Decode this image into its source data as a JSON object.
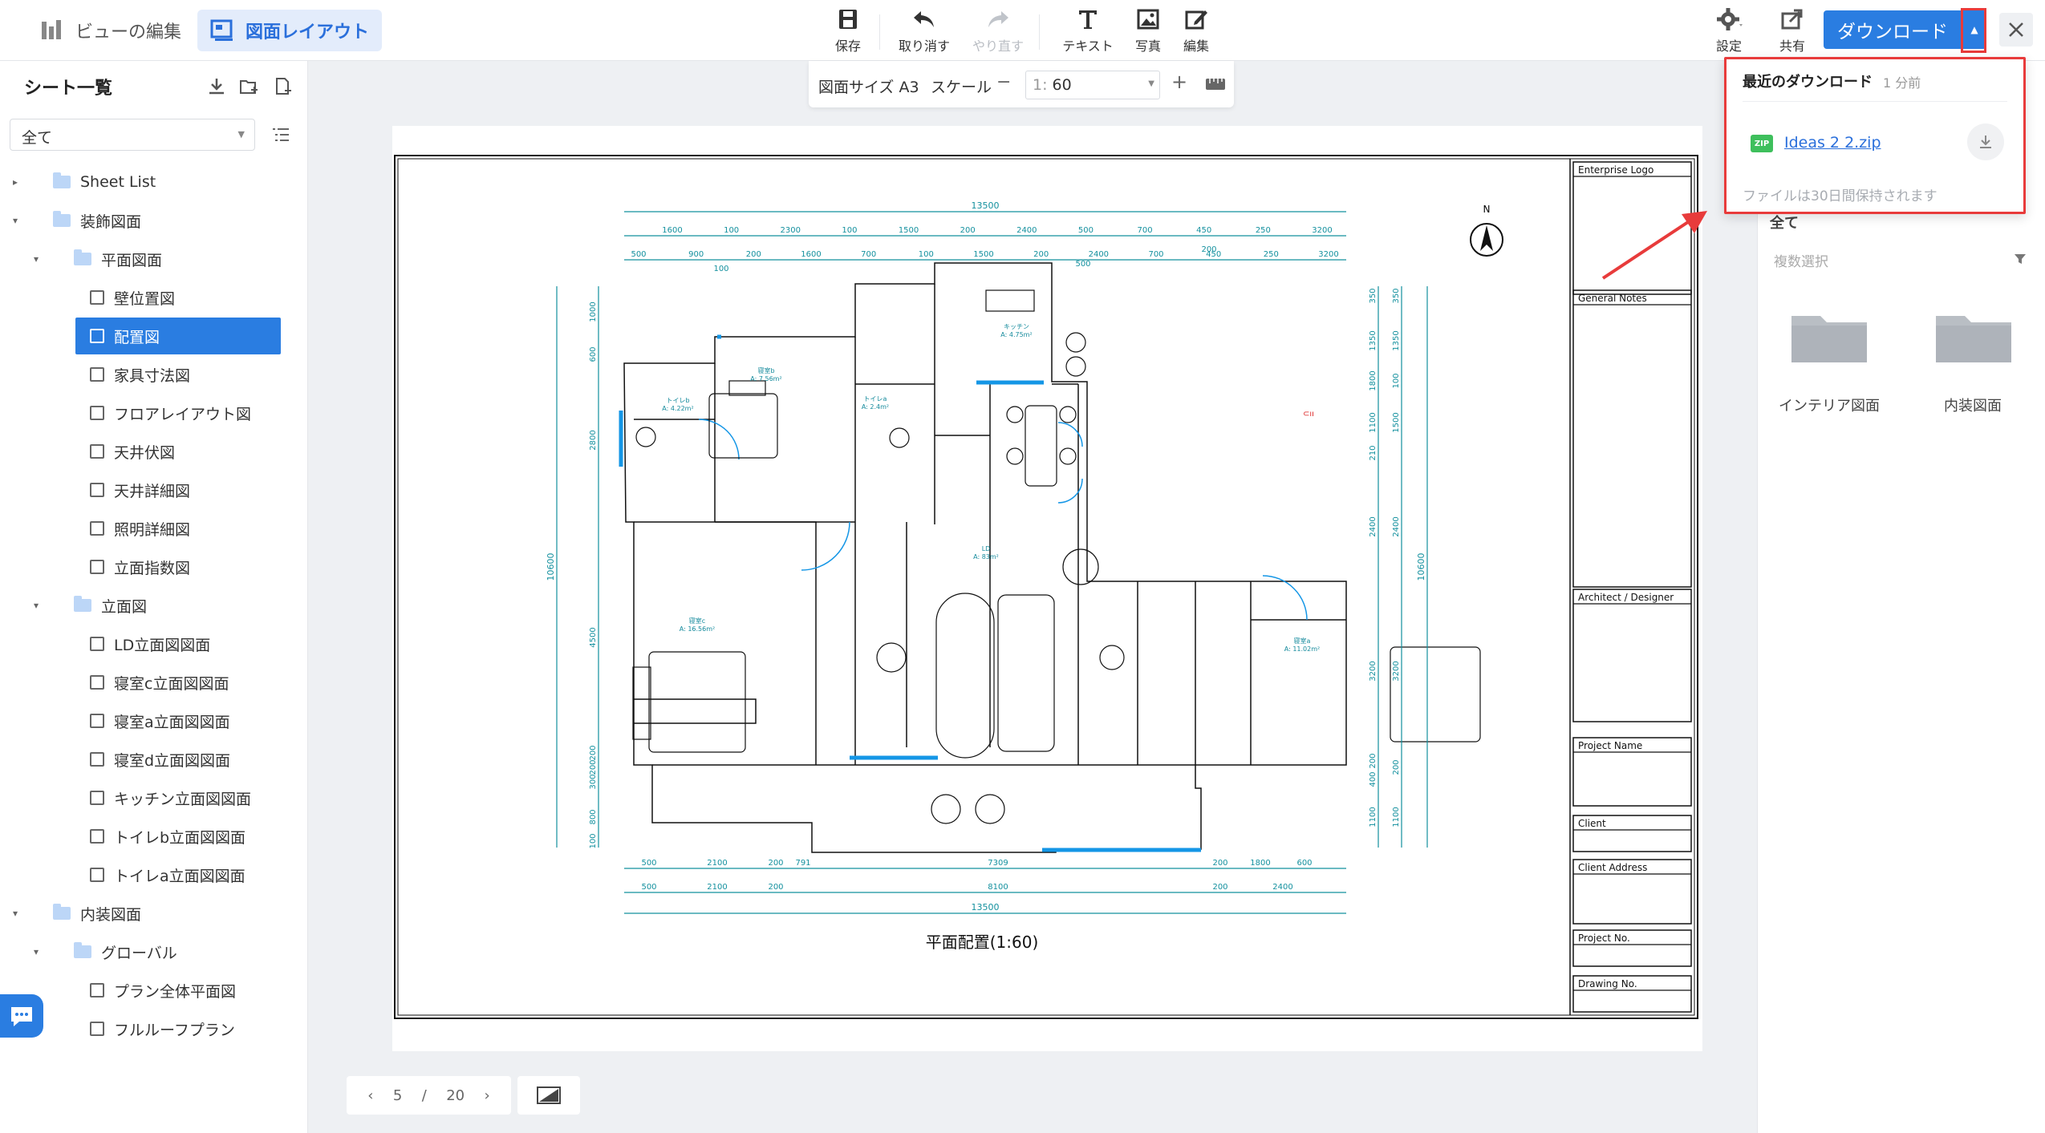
{
  "header": {
    "mode_tabs": [
      {
        "label": "ビューの編集",
        "active": false
      },
      {
        "label": "図面レイアウト",
        "active": true
      }
    ],
    "tools": [
      {
        "label": "保存",
        "icon": "save-icon",
        "disabled": false
      },
      {
        "label": "取り消す",
        "icon": "undo-icon",
        "disabled": false
      },
      {
        "label": "やり直す",
        "icon": "redo-icon",
        "disabled": true
      },
      {
        "label": "テキスト",
        "icon": "text-icon",
        "disabled": false
      },
      {
        "label": "写真",
        "icon": "photo-icon",
        "disabled": false
      },
      {
        "label": "編集",
        "icon": "edit-icon",
        "disabled": false
      }
    ],
    "settings_label": "設定",
    "share_label": "共有",
    "download_label": "ダウンロード",
    "accent_color": "#2a7de1"
  },
  "sidebar": {
    "title": "シート一覧",
    "filter_value": "全て",
    "tree": [
      {
        "label": "Sheet List",
        "type": "folder",
        "level": 0,
        "collapsed": true
      },
      {
        "label": "装飾図面",
        "type": "folder",
        "level": 0
      },
      {
        "label": "平面図面",
        "type": "folder",
        "level": 1
      },
      {
        "label": "壁位置図",
        "type": "sheet",
        "level": 2
      },
      {
        "label": "配置図",
        "type": "sheet",
        "level": 2,
        "selected": true
      },
      {
        "label": "家具寸法図",
        "type": "sheet",
        "level": 2
      },
      {
        "label": "フロアレイアウト図",
        "type": "sheet",
        "level": 2
      },
      {
        "label": "天井伏図",
        "type": "sheet",
        "level": 2
      },
      {
        "label": "天井詳細図",
        "type": "sheet",
        "level": 2
      },
      {
        "label": "照明詳細図",
        "type": "sheet",
        "level": 2
      },
      {
        "label": "立面指数図",
        "type": "sheet",
        "level": 2
      },
      {
        "label": "立面図",
        "type": "folder",
        "level": 1
      },
      {
        "label": "LD立面図図面",
        "type": "sheet",
        "level": 2
      },
      {
        "label": "寝室c立面図図面",
        "type": "sheet",
        "level": 2
      },
      {
        "label": "寝室a立面図図面",
        "type": "sheet",
        "level": 2
      },
      {
        "label": "寝室d立面図図面",
        "type": "sheet",
        "level": 2
      },
      {
        "label": "キッチン立面図図面",
        "type": "sheet",
        "level": 2
      },
      {
        "label": "トイレb立面図図面",
        "type": "sheet",
        "level": 2
      },
      {
        "label": "トイレa立面図図面",
        "type": "sheet",
        "level": 2
      },
      {
        "label": "内装図面",
        "type": "folder",
        "level": 0
      },
      {
        "label": "グローバル",
        "type": "folder",
        "level": 1
      },
      {
        "label": "プラン全体平面図",
        "type": "sheet",
        "level": 2
      },
      {
        "label": "フルルーフプラン",
        "type": "sheet",
        "level": 2
      }
    ]
  },
  "scale_bar": {
    "paper_size_label": "図面サイズ A3",
    "scale_label": "スケール",
    "scale_prefix": "1:",
    "scale_value": "60"
  },
  "drawing": {
    "plan_title": "平面配置(1:60)",
    "north": "N",
    "overall_width_label": "13500",
    "overall_height_label": "10600",
    "top_dims_row1": [
      "1600",
      "100",
      "2300",
      "100",
      "1500",
      "200",
      "2400",
      "500",
      "700",
      "450",
      "250",
      "3200"
    ],
    "top_dims_row2": [
      "500",
      "900",
      "200",
      "1600",
      "700",
      "100",
      "1500",
      "200",
      "2400",
      "700",
      "450",
      "250",
      "3200"
    ],
    "top_dims_sub": [
      "100",
      "500",
      "200"
    ],
    "bottom_dims_row1": [
      "500",
      "2100",
      "200",
      "791",
      "7309",
      "200",
      "1800",
      "600"
    ],
    "bottom_dims_row2": [
      "500",
      "2100",
      "200",
      "8100",
      "200",
      "2400"
    ],
    "left_dims": [
      "1000",
      "600",
      "2800",
      "4500",
      "200",
      "200",
      "300",
      "800",
      "100"
    ],
    "right_dims_outer": [
      "350",
      "1350",
      "1800",
      "1100",
      "210",
      "2400",
      "3200",
      "200",
      "400",
      "1100"
    ],
    "right_dims_inner": [
      "350",
      "1350",
      "100",
      "1500",
      "2400",
      "3200",
      "200",
      "1100"
    ],
    "rooms": [
      {
        "name": "キッチン",
        "area": "A: 4.75m²"
      },
      {
        "name": "寝室b",
        "area": "A: 7.56m²"
      },
      {
        "name": "トイレb",
        "area": "A: 4.22m²"
      },
      {
        "name": "トイレa",
        "area": "A: 2.4m²"
      },
      {
        "name": "LD",
        "area": "A: 83m²"
      },
      {
        "name": "寝室c",
        "area": "A: 16.56m²"
      },
      {
        "name": "寝室a",
        "area": "A: 11.02m²"
      }
    ],
    "title_block": [
      "Enterprise Logo",
      "General Notes",
      "Architect / Designer",
      "Project Name",
      "Client",
      "Client Address",
      "Project No.",
      "Drawing No."
    ]
  },
  "pager": {
    "current": "5",
    "separator": "/",
    "total": "20"
  },
  "right_panel": {
    "filter_label": "全て",
    "multi_select_label": "複数選択",
    "folders": [
      "インテリア図面",
      "内装図面"
    ]
  },
  "download_popup": {
    "heading": "最近のダウンロード",
    "time": "1 分前",
    "file_badge": "ZIP",
    "file_name": "Ideas 2 2.zip",
    "note": "ファイルは30日間保持されます"
  }
}
